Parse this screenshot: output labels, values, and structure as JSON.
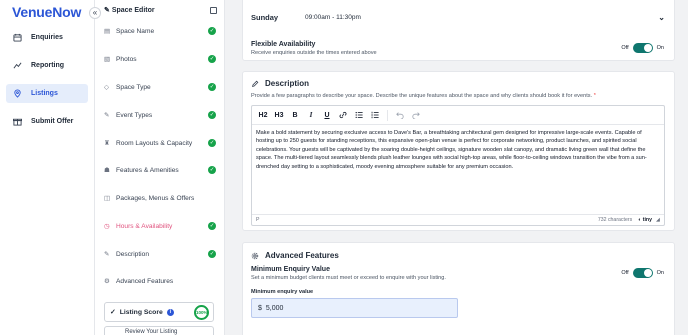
{
  "app": {
    "logo": "VenueNow"
  },
  "nav": {
    "collapse_icon": "«",
    "items": [
      {
        "label": "Enquiries",
        "icon": "calendar-icon"
      },
      {
        "label": "Reporting",
        "icon": "chart-icon"
      },
      {
        "label": "Listings",
        "icon": "location-pin-icon",
        "active": true
      },
      {
        "label": "Submit Offer",
        "icon": "gift-icon"
      }
    ]
  },
  "editor": {
    "title": "Space Editor",
    "title_icon": "pencil-icon",
    "items": [
      {
        "label": "Space Name",
        "icon": "document-icon",
        "done": true
      },
      {
        "label": "Photos",
        "icon": "image-icon",
        "done": true
      },
      {
        "label": "Space Type",
        "icon": "tag-icon",
        "done": true
      },
      {
        "label": "Event Types",
        "icon": "pencil-icon",
        "done": true
      },
      {
        "label": "Room Layouts & Capacity",
        "icon": "chair-icon",
        "done": true
      },
      {
        "label": "Features & Amenities",
        "icon": "amenities-icon",
        "done": true
      },
      {
        "label": "Packages, Menus & Offers",
        "icon": "bag-icon",
        "done": false
      },
      {
        "label": "Hours & Availability",
        "icon": "clock-icon",
        "done": true,
        "active": true
      },
      {
        "label": "Description",
        "icon": "pencil-icon",
        "done": true
      },
      {
        "label": "Advanced Features",
        "icon": "gear-icon",
        "done": false
      }
    ],
    "score_label": "Listing Score",
    "score_info": "i",
    "score_value": "100%",
    "review_label": "Review Your Listing"
  },
  "hours": {
    "day": "Sunday",
    "time": "09:00am - 11:30pm",
    "flex_title": "Flexible Availability",
    "flex_sub": "Receive enquiries outside the times entered above",
    "toggle_off": "Off",
    "toggle_on": "On"
  },
  "description": {
    "title": "Description",
    "hint": "Provide a few paragraphs to describe your space. Describe the unique features about the space and why clients should book it for events.",
    "required_mark": "*",
    "toolbar": [
      "H2",
      "H3"
    ],
    "text": "Make a bold statement by securing exclusive access to Dave's Bar, a breathtaking architectural gem designed for impressive large-scale events. Capable of hosting up to 250 guests for standing receptions, this expansive open-plan venue is perfect for corporate networking, product launches, and spirited social celebrations. Your guests will be captivated by the soaring double-height ceilings, signature wooden slat canopy, and dramatic living green wall that define the space. The multi-tiered layout seamlessly blends plush leather lounges with social high-top areas, while floor-to-ceiling windows transition the vibe from a sun-drenched day setting to a sophisticated, moody evening atmosphere suitable for any premium occasion.",
    "status_path": "P",
    "char_count": "732 characters",
    "brand": "tiny"
  },
  "advanced": {
    "title": "Advanced Features",
    "min_title": "Minimum Enquiry Value",
    "min_sub": "Set a minimum budget clients must meet or exceed to enquire with your listing.",
    "toggle_off": "Off",
    "toggle_on": "On",
    "min_label": "Minimum enquiry value",
    "currency": "$",
    "min_value": "5,000"
  },
  "colors": {
    "brand": "#2c56d6",
    "success": "#16a34a",
    "toggle": "#0f766e",
    "active_pink": "#e0527e"
  }
}
